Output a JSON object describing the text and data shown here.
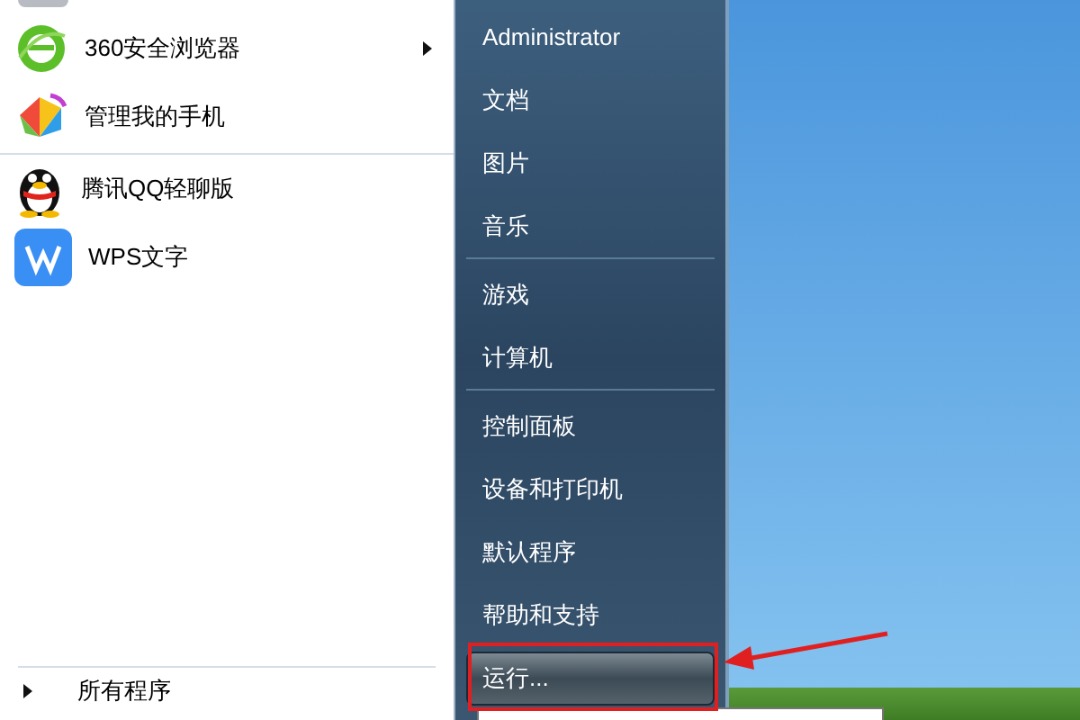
{
  "programs": [
    {
      "label": "360安全浏览器",
      "has_submenu": true,
      "separator_after": false
    },
    {
      "label": "管理我的手机",
      "has_submenu": false,
      "separator_after": true
    },
    {
      "label": "腾讯QQ轻聊版",
      "has_submenu": false,
      "separator_after": false
    },
    {
      "label": "WPS文字",
      "has_submenu": false,
      "separator_after": false
    }
  ],
  "all_programs": {
    "label": "所有程序"
  },
  "places": [
    {
      "label": "Administrator",
      "selected": false,
      "separator_after": false
    },
    {
      "label": "文档",
      "selected": false,
      "separator_after": false
    },
    {
      "label": "图片",
      "selected": false,
      "separator_after": false
    },
    {
      "label": "音乐",
      "selected": false,
      "separator_after": true
    },
    {
      "label": "游戏",
      "selected": false,
      "separator_after": false
    },
    {
      "label": "计算机",
      "selected": false,
      "separator_after": true
    },
    {
      "label": "控制面板",
      "selected": false,
      "separator_after": false
    },
    {
      "label": "设备和打印机",
      "selected": false,
      "separator_after": false
    },
    {
      "label": "默认程序",
      "selected": false,
      "separator_after": false
    },
    {
      "label": "帮助和支持",
      "selected": false,
      "separator_after": false
    },
    {
      "label": "运行...",
      "selected": true,
      "separator_after": false
    }
  ]
}
